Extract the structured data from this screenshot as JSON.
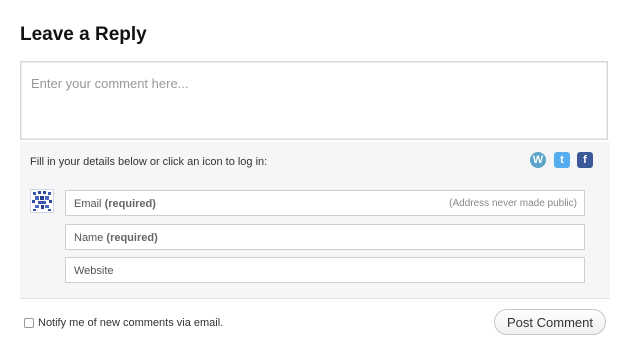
{
  "heading": "Leave a Reply",
  "comment": {
    "placeholder": "Enter your comment here..."
  },
  "login": {
    "prompt": "Fill in your details below or click an icon to log in:",
    "icons": [
      {
        "name": "wordpress-icon",
        "glyph": "W",
        "color": "#5ba3c9"
      },
      {
        "name": "twitter-icon",
        "glyph": "t",
        "color": "#55acee"
      },
      {
        "name": "facebook-icon",
        "glyph": "f",
        "color": "#3b5998"
      }
    ]
  },
  "fields": {
    "email": {
      "label": "Email",
      "required": "(required)",
      "hint": "(Address never made public)"
    },
    "name": {
      "label": "Name",
      "required": "(required)"
    },
    "website": {
      "label": "Website"
    }
  },
  "notify": {
    "label": "Notify me of new comments via email."
  },
  "submit": {
    "label": "Post Comment"
  }
}
